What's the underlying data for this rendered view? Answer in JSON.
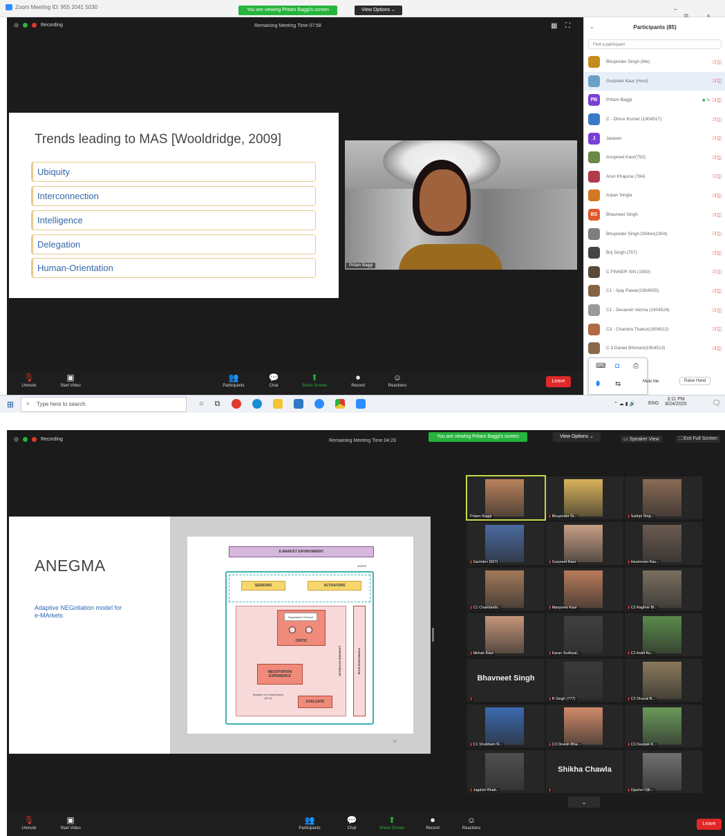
{
  "shot1": {
    "window_title": "Zoom Meeting ID: 955 2041 5030",
    "banner": "You are viewing Pritam Baggi's screen",
    "view_options": "View Options ⌄",
    "recording": "Recording",
    "remaining": "Remaining Meeting Time 07:58",
    "slide": {
      "title": "Trends leading to MAS [Wooldridge, 2009]",
      "items": [
        "Ubiquity",
        "Interconnection",
        "Intelligence",
        "Delegation",
        "Human-Orientation"
      ]
    },
    "speaker_label": "Pritam Baggi",
    "participants": {
      "title": "Participants (85)",
      "search_placeholder": "Find a participant",
      "list": [
        {
          "name": "Bhupinder Singh (Me)",
          "color": "#c58b1f",
          "initials": ""
        },
        {
          "name": "Gurpreet Kaur (Host)",
          "color": "#6aa0c8",
          "initials": ""
        },
        {
          "name": "Pritam Baggi",
          "color": "#7b3fd6",
          "initials": "PB"
        },
        {
          "name": "C - Dhruv Kumar (1904517)",
          "color": "#3a79c7",
          "initials": ""
        },
        {
          "name": "Jasleen",
          "color": "#7b3fd6",
          "initials": "J"
        },
        {
          "name": "Anupreet Kaur(752)",
          "color": "#6a8a45",
          "initials": ""
        },
        {
          "name": "Arun Khajuria (784)",
          "color": "#b23a4a",
          "initials": ""
        },
        {
          "name": "Arpan Singla",
          "color": "#d37722",
          "initials": ""
        },
        {
          "name": "Bhavneet Singh",
          "color": "#e0582c",
          "initials": "BS"
        },
        {
          "name": "Bhupinder Singh Dhillon(1904)",
          "color": "#7e7e7e",
          "initials": ""
        },
        {
          "name": "Brij Singh (757)",
          "color": "#444",
          "initials": ""
        },
        {
          "name": "C FINNER SIN (1900)",
          "color": "#5a4a3a",
          "initials": ""
        },
        {
          "name": "C1 - Ajay Pawar(1904505)",
          "color": "#846444",
          "initials": ""
        },
        {
          "name": "C1 - Devansh Verma (1904524)",
          "color": "#9a9a9a",
          "initials": ""
        },
        {
          "name": "C3 - Chandra Thakur(1904512)",
          "color": "#b06a44",
          "initials": ""
        },
        {
          "name": "C 3 Daniel Bhimani(1904513)",
          "color": "#8a6a4a",
          "initials": ""
        }
      ],
      "invite": "Invite",
      "mute_me": "Mute Me",
      "raise_hand": "Raise Hand"
    },
    "toolbar": {
      "unmute": "Unmute",
      "start_video": "Start Video",
      "participants": "Participants",
      "participants_count": "85",
      "chat": "Chat",
      "share_screen": "Share Screen",
      "record": "Record",
      "reactions": "Reactions",
      "leave": "Leave"
    },
    "taskbar": {
      "search": "Type here to search",
      "time": "3:11 PM",
      "date": "8/24/2020",
      "lang": "ENG"
    }
  },
  "shot2": {
    "recording": "Recording",
    "remaining": "Remaining Meeting Time 04:23",
    "banner": "You are viewing Pritam Baggi's screen",
    "view_options": "View Options ⌄",
    "speaker_view": "Speaker View",
    "exit_full": "Exit Full Screen",
    "slide": {
      "title": "ANEGMA",
      "subtitle_line1": "Adaptive NEGotiation model for",
      "subtitle_line2": "e-MArkets",
      "page": "19"
    },
    "diagram": {
      "env": "E-MARKET ENVIRONMENT",
      "agent": "AGENT",
      "sensors": "SENSORS",
      "actuators": "ACTUATORS",
      "negotiation_protocol": "Negotiation Protocol",
      "critic": "CRITIC",
      "kb": "KNOWLEDGE BASE",
      "ld": "LEARNING DATABASE",
      "nea": "NEGOTIATION EXPERIENCE",
      "sample": "Sample of n Experiences (E1:n)",
      "evaluate": "EVALUATE"
    },
    "tiles": [
      {
        "name": "Pritam Baggi"
      },
      {
        "name": "Bhupinder Si..."
      },
      {
        "name": "Sukhjit Sing..."
      },
      {
        "name": "Sachdev (557)"
      },
      {
        "name": "Gurpreet Kaur"
      },
      {
        "name": "Harsimran Kau..."
      },
      {
        "name": "C1 Chandanbi..."
      },
      {
        "name": "Manpreet Kaur"
      },
      {
        "name": "C3 Raghvir Bi..."
      },
      {
        "name": "Mehak Kaur"
      },
      {
        "name": "Karan Sudhyal..."
      },
      {
        "name": "C3 Ankit Ku..."
      },
      {
        "name": "Bhavneet Singh"
      },
      {
        "name": "R Singh (777)"
      },
      {
        "name": "C2 Dhaval B..."
      },
      {
        "name": "C1 Shubham N..."
      },
      {
        "name": "C3 Dinesh Bha..."
      },
      {
        "name": "C3 Deepak K..."
      },
      {
        "name": "Jagdish Bhati..."
      },
      {
        "name": "Shikha Chawla"
      },
      {
        "name": "Ojashvi Ojh..."
      }
    ],
    "toolbar": {
      "unmute": "Unmute",
      "start_video": "Start Video",
      "participants": "Participants",
      "participants_count": "70",
      "chat": "Chat",
      "share_screen": "Share Screen",
      "record": "Record",
      "reactions": "Reactions",
      "leave": "Leave"
    }
  }
}
